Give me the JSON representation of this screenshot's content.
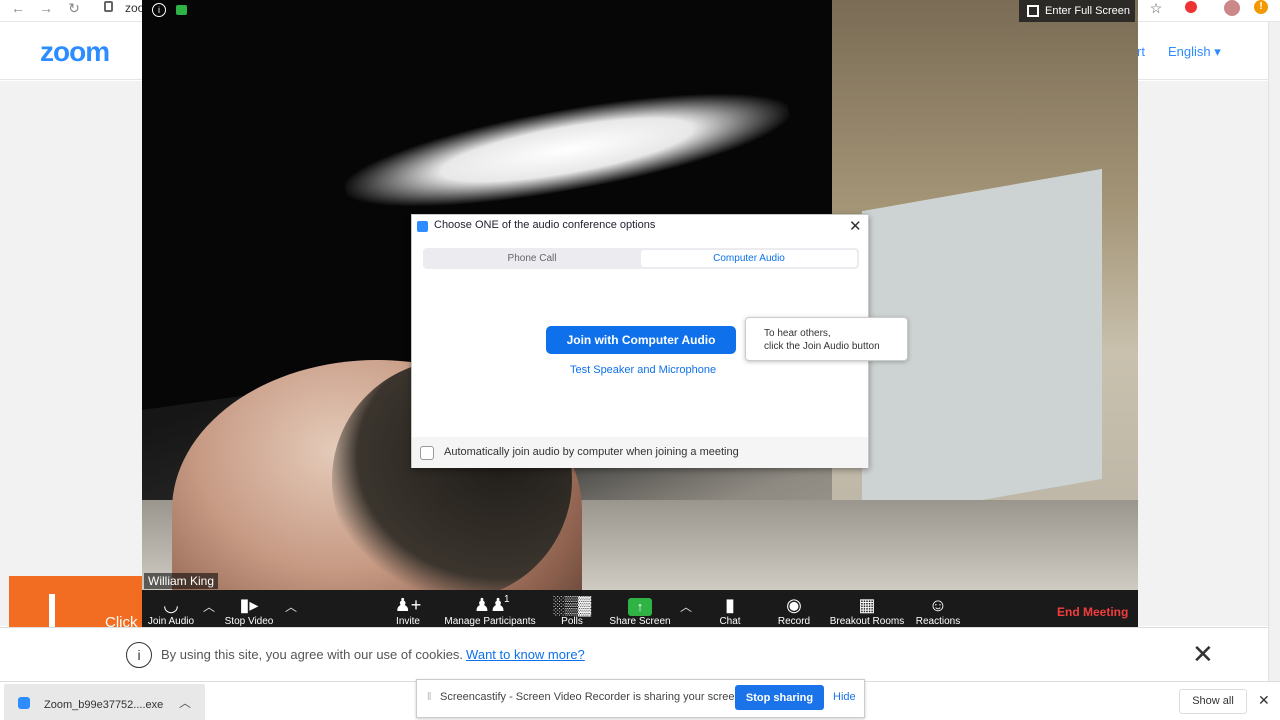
{
  "browser": {
    "url_fragment": "zoo",
    "nav_back": "←",
    "nav_forward": "→",
    "reload": "↻",
    "star": "☆",
    "alert": "!"
  },
  "site": {
    "logo": "zoom",
    "nav_link": "rt",
    "language": "English ▾"
  },
  "promo": {
    "text": "Click"
  },
  "meeting": {
    "participant_name": "William King",
    "fullscreen_label": "Enter Full Screen",
    "toolbar": {
      "join_audio": "Join Audio",
      "stop_video": "Stop Video",
      "invite": "Invite",
      "manage_participants": "Manage Participants",
      "participant_count": "1",
      "polls": "Polls",
      "share_screen": "Share Screen",
      "chat": "Chat",
      "record": "Record",
      "breakout_rooms": "Breakout Rooms",
      "reactions": "Reactions",
      "end_meeting": "End Meeting"
    }
  },
  "dialog": {
    "title": "Choose ONE of the audio conference options",
    "tabs": [
      "Phone Call",
      "Computer Audio"
    ],
    "active_tab": "Computer Audio",
    "join_button": "Join with Computer Audio",
    "test_link": "Test Speaker and Microphone",
    "auto_join_label": "Automatically join audio by computer when joining a meeting",
    "auto_join_checked": false
  },
  "tooltip": {
    "line1": "To hear others,",
    "line2": "click the Join Audio button"
  },
  "cookie": {
    "text": "By using this site, you agree with our use of cookies.",
    "link": "Want to know more?"
  },
  "downloads": {
    "file_name": "Zoom_b99e37752....exe",
    "show_all": "Show all"
  },
  "screencastify": {
    "message": "Screencastify - Screen Video Recorder is sharing your screen.",
    "stop_button": "Stop sharing",
    "hide": "Hide"
  },
  "colors": {
    "zoom_blue": "#2D8CFF",
    "button_blue": "#0e71eb",
    "end_red": "#f23d3d",
    "share_green": "#2fb344",
    "promo_orange": "#f26d21"
  }
}
